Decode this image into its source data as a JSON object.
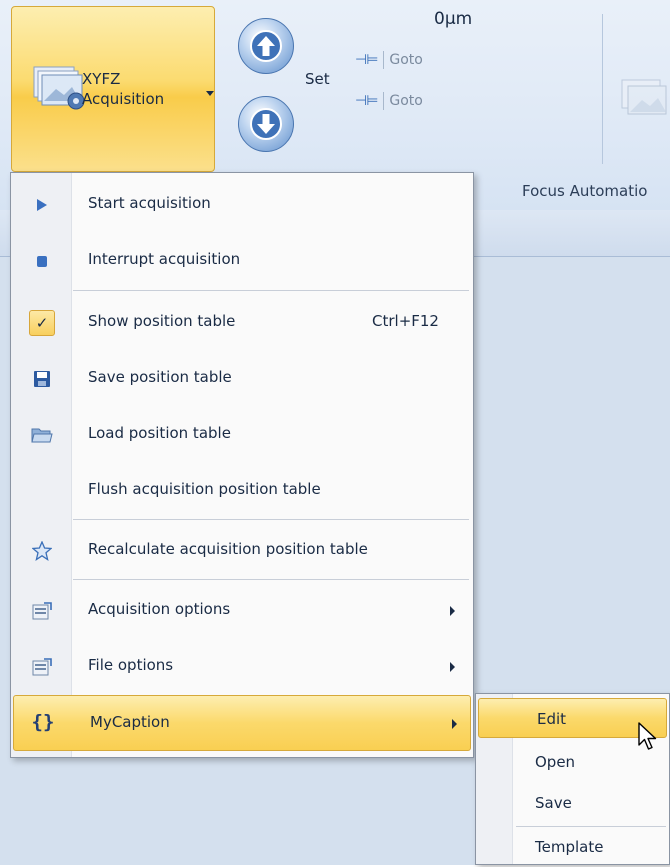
{
  "ribbon": {
    "acquisition_button": {
      "line1": "XYFZ",
      "line2": "Acquisition"
    },
    "z_value": "0µm",
    "set_label": "Set",
    "goto_labels": [
      "Goto",
      "Goto"
    ],
    "group_label": "Focus Automatio"
  },
  "menu": {
    "items": [
      {
        "label": "Start acquisition",
        "icon": "play-icon"
      },
      {
        "label": "Interrupt acquisition",
        "icon": "stop-icon"
      },
      {
        "label": "Show position table",
        "shortcut": "Ctrl+F12",
        "icon": "check-icon",
        "checked": true
      },
      {
        "label": "Save position table",
        "icon": "save-icon"
      },
      {
        "label": "Load position table",
        "icon": "folder-open-icon"
      },
      {
        "label": "Flush acquisition position table",
        "icon": ""
      },
      {
        "label": "Recalculate acquisition position table",
        "icon": "star-icon"
      },
      {
        "label": "Acquisition options",
        "icon": "options-icon",
        "submenu": true
      },
      {
        "label": "File options",
        "icon": "options-icon",
        "submenu": true
      },
      {
        "label": "MyCaption",
        "icon": "script-icon",
        "submenu": true,
        "highlighted": true
      }
    ]
  },
  "submenu": {
    "items": [
      {
        "label": "Edit",
        "highlighted": true
      },
      {
        "label": "Open"
      },
      {
        "label": "Save"
      },
      {
        "label": "Template"
      }
    ]
  },
  "colors": {
    "highlight": "#f9cf52",
    "ribbon_bg": "#dfe9f6",
    "content_bg": "#d4e0ee"
  }
}
